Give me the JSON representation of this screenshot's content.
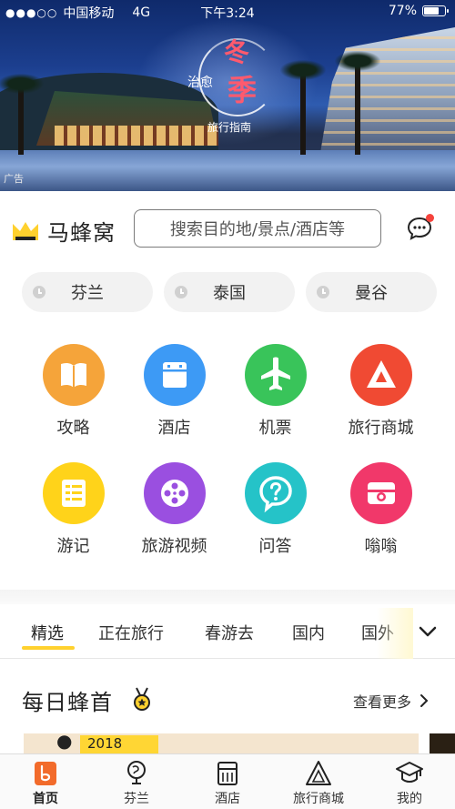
{
  "status_bar": {
    "signal": "●●●○○",
    "carrier": "中国移动",
    "network": "4G",
    "time": "下午3:24",
    "battery": "77%",
    "battery_level": 0.77
  },
  "banner": {
    "title_big_1": "冬",
    "title_big_2": "季",
    "title_small_1": "治愈",
    "title_small_2": "旅行指南",
    "ad_label": "广告"
  },
  "header": {
    "brand": "马蜂窝",
    "search_placeholder": "搜索目的地/景点/酒店等"
  },
  "recent": [
    "芬兰",
    "泰国",
    "曼谷"
  ],
  "grid": [
    {
      "label": "攻略",
      "icon": "book-icon",
      "color": "#f5a43a"
    },
    {
      "label": "酒店",
      "icon": "hotel-icon",
      "color": "#3d9af5"
    },
    {
      "label": "机票",
      "icon": "airplane-icon",
      "color": "#39c45a"
    },
    {
      "label": "旅行商城",
      "icon": "mountain-icon",
      "color": "#f04a33"
    },
    {
      "label": "游记",
      "icon": "notes-icon",
      "color": "#ffd31a"
    },
    {
      "label": "旅游视频",
      "icon": "film-reel-icon",
      "color": "#9a4fe0"
    },
    {
      "label": "问答",
      "icon": "question-icon",
      "color": "#25c3c8"
    },
    {
      "label": "嗡嗡",
      "icon": "camera-icon",
      "color": "#f1386a"
    }
  ],
  "tabs": [
    "精选",
    "正在旅行",
    "春游去",
    "国内",
    "国外"
  ],
  "daily": {
    "title": "每日蜂首",
    "see_more": "查看更多",
    "card_year": "2018"
  },
  "bottom_nav": [
    {
      "label": "首页",
      "icon": "home-icon"
    },
    {
      "label": "芬兰",
      "icon": "globe-icon"
    },
    {
      "label": "酒店",
      "icon": "hotel-icon"
    },
    {
      "label": "旅行商城",
      "icon": "mountain-icon"
    },
    {
      "label": "我的",
      "icon": "graduation-cap-icon"
    }
  ]
}
